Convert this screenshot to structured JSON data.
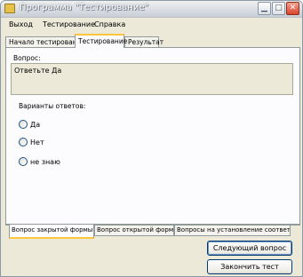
{
  "window": {
    "title": "Программа \"Тестирование\""
  },
  "menu": [
    {
      "label": "Выход"
    },
    {
      "label": "Тестирование"
    },
    {
      "label": "Справка"
    }
  ],
  "top_tabs": [
    {
      "label": "Начало тестирования"
    },
    {
      "label": "Тестирование"
    },
    {
      "label": "Результат"
    }
  ],
  "question": {
    "group_label": "Вопрос:",
    "text": "Ответьте Да"
  },
  "answers": {
    "label": "Варианты ответов:",
    "options": [
      {
        "label": "Да"
      },
      {
        "label": "Нет"
      },
      {
        "label": "не знаю"
      }
    ]
  },
  "bottom_tabs": [
    {
      "label": "Вопрос закрытой формы"
    },
    {
      "label": "Вопрос открытой формы"
    },
    {
      "label": "Вопросы на установление соответ"
    }
  ],
  "buttons": {
    "next": "Следующий вопрос",
    "finish": "Закончить тест"
  }
}
